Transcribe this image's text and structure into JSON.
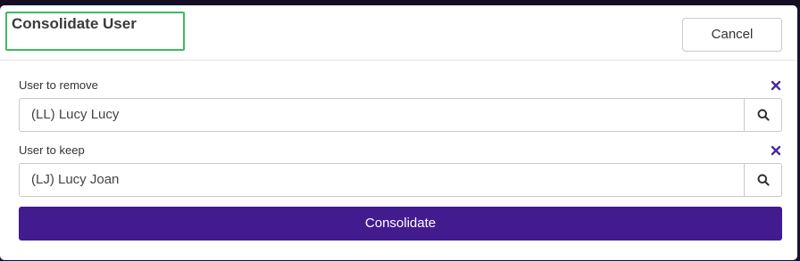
{
  "dialog": {
    "title": "Consolidate User",
    "cancel_label": "Cancel"
  },
  "fields": [
    {
      "label": "User to remove",
      "value": "(LL) Lucy Lucy",
      "clear_icon": "close-icon",
      "search_icon": "search-icon"
    },
    {
      "label": "User to keep",
      "value": "(LJ) Lucy Joan",
      "clear_icon": "close-icon",
      "search_icon": "search-icon"
    }
  ],
  "consolidate_label": "Consolidate",
  "colors": {
    "primary": "#421c8f",
    "clear_icon": "#4b2a9e",
    "highlight_border": "#3dbb5d"
  }
}
